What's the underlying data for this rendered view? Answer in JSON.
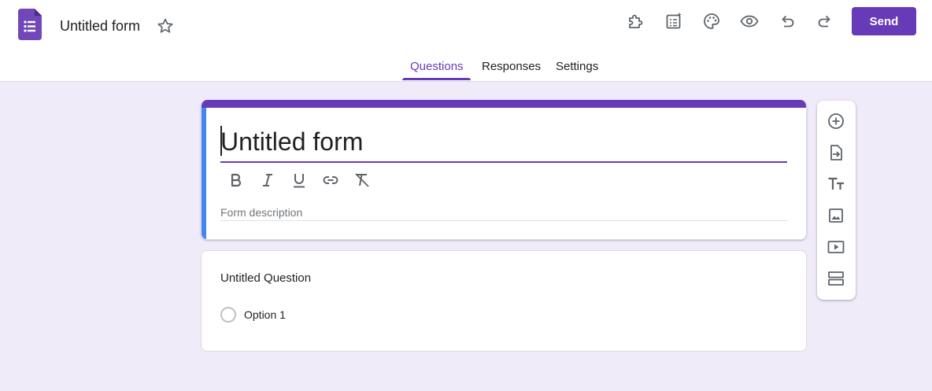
{
  "header": {
    "doc_title": "Untitled form",
    "send_label": "Send",
    "icons": [
      "addons-icon",
      "ai-checklist-icon",
      "palette-icon",
      "preview-eye-icon",
      "undo-icon",
      "redo-icon"
    ]
  },
  "tabs": [
    {
      "label": "Questions",
      "active": true
    },
    {
      "label": "Responses",
      "active": false
    },
    {
      "label": "Settings",
      "active": false
    }
  ],
  "form": {
    "title": "Untitled form",
    "description_placeholder": "Form description",
    "format_tools": [
      "bold-icon",
      "italic-icon",
      "underline-icon",
      "link-icon",
      "clear-format-icon"
    ]
  },
  "question": {
    "title": "Untitled Question",
    "options": [
      "Option 1"
    ]
  },
  "side_toolbar": [
    "add-question-icon",
    "import-questions-icon",
    "add-title-icon",
    "add-image-icon",
    "add-video-icon",
    "add-section-icon"
  ],
  "colors": {
    "accent": "#673ab7",
    "background": "#f0ebf8",
    "title_left_band": "#4285f4"
  }
}
